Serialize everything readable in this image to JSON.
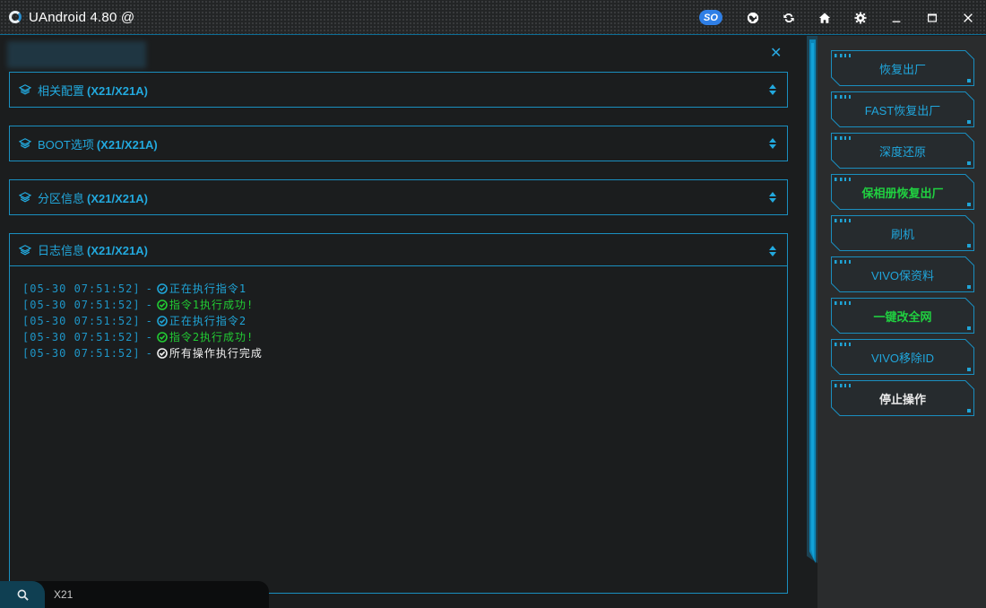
{
  "app": {
    "title": "UAndroid 4.80 @",
    "badge": "SO"
  },
  "titlebar_icons": [
    "globe-icon",
    "refresh-icon",
    "home-icon",
    "gear-icon",
    "minimize-icon",
    "maximize-icon",
    "close-icon"
  ],
  "panels": [
    {
      "label": "相关配置",
      "model": "(X21/X21A)"
    },
    {
      "label": "BOOT选项",
      "model": "(X21/X21A)"
    },
    {
      "label": "分区信息",
      "model": "(X21/X21A)"
    },
    {
      "label": "日志信息",
      "model": "(X21/X21A)"
    }
  ],
  "log": [
    {
      "time": "[05-30 07:51:52]",
      "sep": "-",
      "message": "正在执行指令1",
      "status": "info"
    },
    {
      "time": "[05-30 07:51:52]",
      "sep": "-",
      "message": "指令1执行成功!",
      "status": "success"
    },
    {
      "time": "[05-30 07:51:52]",
      "sep": "-",
      "message": "正在执行指令2",
      "status": "info"
    },
    {
      "time": "[05-30 07:51:52]",
      "sep": "-",
      "message": "指令2执行成功!",
      "status": "success"
    },
    {
      "time": "[05-30 07:51:52]",
      "sep": "-",
      "message": "所有操作执行完成",
      "status": "done"
    }
  ],
  "search": {
    "value": "X21",
    "placeholder": ""
  },
  "sidebar_buttons": [
    {
      "label": "恢复出厂",
      "style": "blue"
    },
    {
      "label": "FAST恢复出厂",
      "style": "blue"
    },
    {
      "label": "深度还原",
      "style": "blue"
    },
    {
      "label": "保相册恢复出厂",
      "style": "green"
    },
    {
      "label": "刷机",
      "style": "blue"
    },
    {
      "label": "VIVO保资料",
      "style": "blue"
    },
    {
      "label": "一键改全网",
      "style": "green"
    },
    {
      "label": "VIVO移除ID",
      "style": "blue"
    },
    {
      "label": "停止操作",
      "style": "white"
    }
  ],
  "colors": {
    "accent": "#1fa4d6",
    "success": "#22cc33",
    "background": "#1b1d1e",
    "sidebar": "#2a2c2d",
    "badge": "#2f7fe6"
  }
}
